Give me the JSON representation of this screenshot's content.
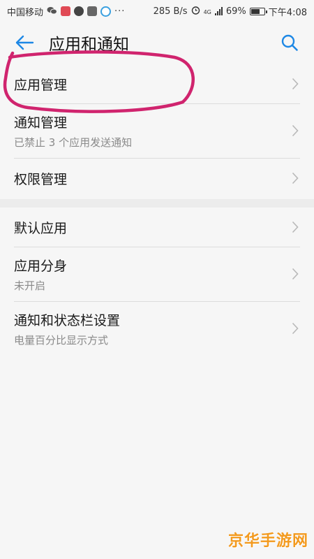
{
  "status_bar": {
    "carrier": "中国移动",
    "network_speed": "285 B/s",
    "network_type": "4G",
    "battery": "69%",
    "battery_level": 0.69,
    "time": "下午4:08",
    "dots": "···"
  },
  "app_bar": {
    "title": "应用和通知",
    "back_icon": "back-arrow-icon",
    "search_icon": "search-icon",
    "accent_color": "#1e88e5"
  },
  "section_1": [
    {
      "title": "应用管理",
      "subtitle": ""
    },
    {
      "title": "通知管理",
      "subtitle": "已禁止 3 个应用发送通知"
    },
    {
      "title": "权限管理",
      "subtitle": ""
    }
  ],
  "section_2": [
    {
      "title": "默认应用",
      "subtitle": ""
    },
    {
      "title": "应用分身",
      "subtitle": "未开启"
    },
    {
      "title": "通知和状态栏设置",
      "subtitle": "电量百分比显示方式"
    }
  ],
  "highlight_color": "#d0246e",
  "watermark": "京华手游网"
}
